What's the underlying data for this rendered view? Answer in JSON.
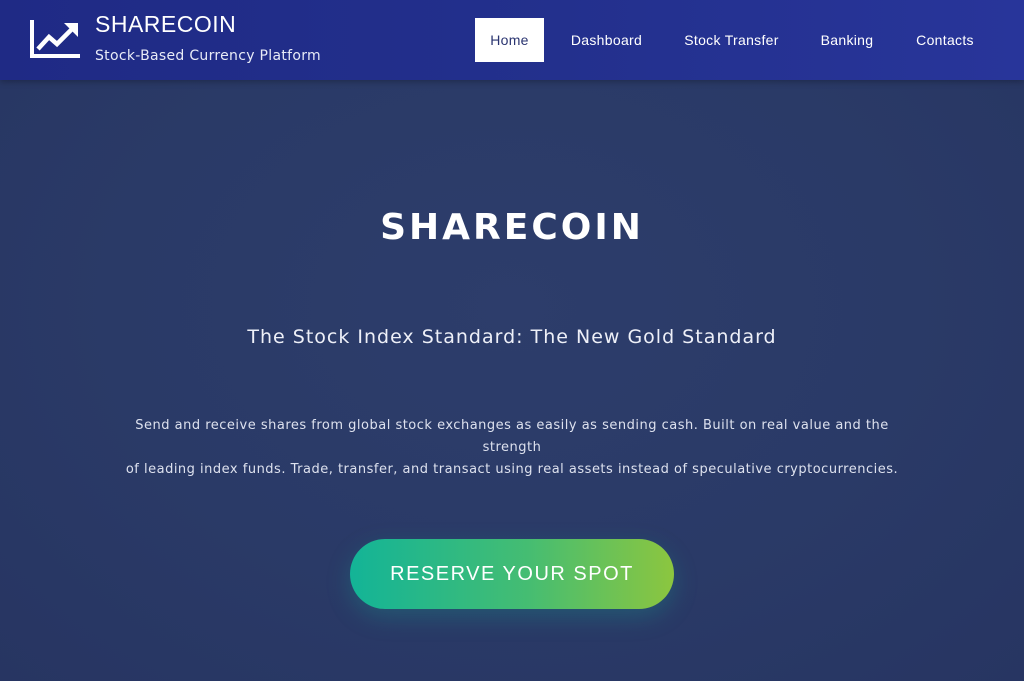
{
  "header": {
    "logo_icon": "trending-up-chart-icon",
    "brand_title": "SHARECOIN",
    "brand_subtitle": "Stock-Based Currency Platform",
    "nav": [
      {
        "label": "Home",
        "active": true
      },
      {
        "label": "Dashboard",
        "active": false
      },
      {
        "label": "Stock Transfer",
        "active": false
      },
      {
        "label": "Banking",
        "active": false
      },
      {
        "label": "Contacts",
        "active": false
      }
    ]
  },
  "hero": {
    "title": "SHARECOIN",
    "tagline": "The Stock Index Standard: The New Gold Standard",
    "description_line1": "Send and receive shares from global stock exchanges as easily as sending cash. Built on real value and the strength",
    "description_line2": "of leading index funds. Trade, transfer, and transact using real assets instead of speculative cryptocurrencies.",
    "cta_label": "RESERVE YOUR SPOT"
  },
  "colors": {
    "header_bg": "#23308d",
    "page_bg": "#2b3a66",
    "cta_gradient_start": "#13b497",
    "cta_gradient_end": "#8cc63f",
    "active_nav_bg": "#ffffff"
  }
}
